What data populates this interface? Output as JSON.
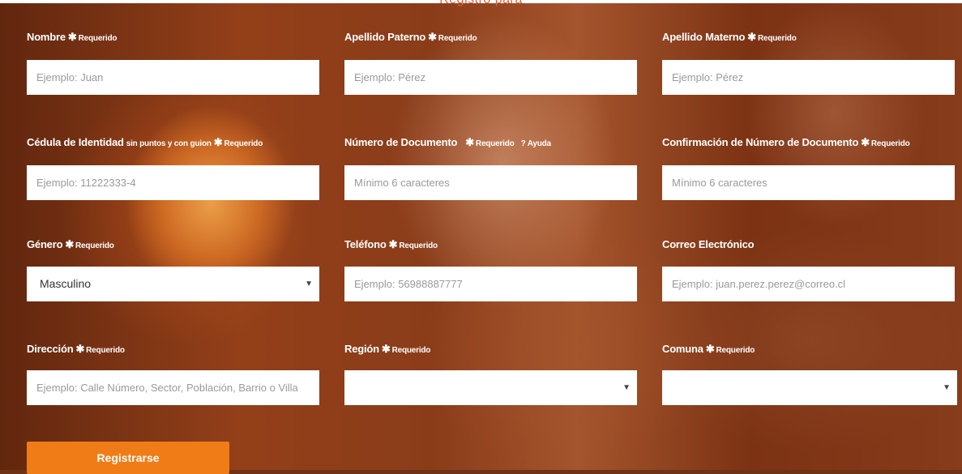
{
  "top_note": "Registro para",
  "required_text": "Requerido",
  "fields": {
    "nombre": {
      "label": "Nombre",
      "placeholder": "Ejemplo: Juan"
    },
    "apellido_paterno": {
      "label": "Apellido Paterno",
      "placeholder": "Ejemplo: Pérez"
    },
    "apellido_materno": {
      "label": "Apellido Materno",
      "placeholder": "Ejemplo: Pérez"
    },
    "cedula": {
      "label": "Cédula de Identidad",
      "hint": "sin puntos y con guion",
      "placeholder": "Ejemplo: 11222333-4"
    },
    "numero_documento": {
      "label": "Número de Documento",
      "help": "? Ayuda",
      "placeholder": "Mínimo 6 caracteres"
    },
    "confirmacion_documento": {
      "label": "Confirmación de Número de Documento",
      "placeholder": "Mínimo 6 caracteres"
    },
    "genero": {
      "label": "Género",
      "value": "Masculino"
    },
    "telefono": {
      "label": "Teléfono",
      "placeholder": "Ejemplo: 56988887777"
    },
    "correo": {
      "label": "Correo Electrónico",
      "placeholder": "Ejemplo: juan.perez.perez@correo.cl"
    },
    "direccion": {
      "label": "Dirección",
      "placeholder": "Ejemplo: Calle Número, Sector, Población, Barrio o Villa"
    },
    "region": {
      "label": "Región",
      "value": ""
    },
    "comuna": {
      "label": "Comuna",
      "value": ""
    }
  },
  "register_button": "Registrarse",
  "colors": {
    "accent": "#f07c17",
    "top_note": "#e0613b"
  }
}
